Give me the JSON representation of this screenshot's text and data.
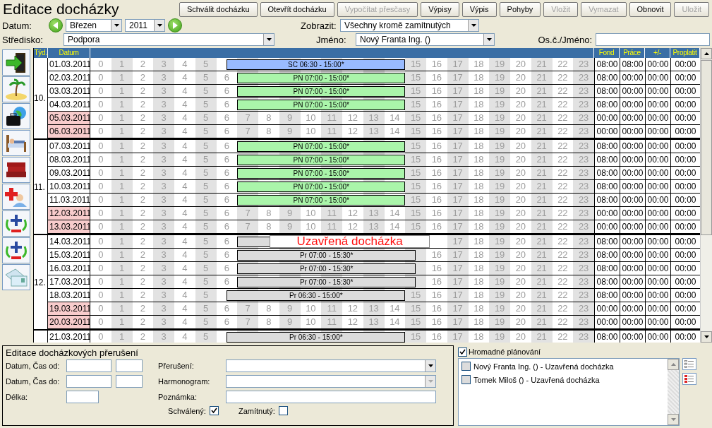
{
  "title": "Editace docházky",
  "toolbar": [
    {
      "label": "Schválit docházku",
      "disabled": false
    },
    {
      "label": "Otevřít docházku",
      "disabled": false
    },
    {
      "label": "Vypočítat přesčasy",
      "disabled": true
    },
    {
      "label": "Výpisy",
      "disabled": false
    },
    {
      "label": "Výpis",
      "disabled": false
    },
    {
      "label": "Pohyby",
      "disabled": false
    },
    {
      "label": "Vložit",
      "disabled": true
    },
    {
      "label": "Vymazat",
      "disabled": true
    },
    {
      "label": "Obnovit",
      "disabled": false
    },
    {
      "label": "Uložit",
      "disabled": true
    }
  ],
  "filters": {
    "datum_label": "Datum:",
    "month": "Březen",
    "year": "2011",
    "zobrazit_label": "Zobrazit:",
    "zobrazit": "Všechny kromě zamítnutých",
    "stredisko_label": "Středisko:",
    "stredisko": "Podpora",
    "jmeno_label": "Jméno:",
    "jmeno": "Nový Franta Ing. ()",
    "search_label": "Os.č./Jméno:"
  },
  "table": {
    "columns": {
      "week": "Týd.",
      "date": "Datum",
      "fond": "Fond",
      "prace": "Práce",
      "diff": "+/-",
      "paid": "Proplatit"
    },
    "weeks": [
      {
        "label": "10.",
        "days": [
          {
            "date": "01.03.2011",
            "weekend": false,
            "hours_before": [
              "0",
              "1",
              "2",
              "3",
              "4",
              "5"
            ],
            "hours_after": [
              "15",
              "16",
              "17",
              "18",
              "19",
              "20",
              "21",
              "22",
              "23"
            ],
            "bar": {
              "label": "SC 06:30 - 15:00*",
              "color": "#99bbff"
            },
            "fond": "08:00",
            "prace": "08:00",
            "diff": "00:00",
            "paid": "00:00"
          },
          {
            "date": "02.03.2011",
            "weekend": false,
            "hours_before": [
              "0",
              "1",
              "2",
              "3",
              "4",
              "5",
              "6"
            ],
            "hours_after": [
              "15",
              "16",
              "17",
              "18",
              "19",
              "20",
              "21",
              "22",
              "23"
            ],
            "bar": {
              "label": "PN 07:00 - 15:00*",
              "color": "#aaf5aa"
            },
            "fond": "08:00",
            "prace": "00:00",
            "diff": "00:00",
            "paid": "00:00"
          },
          {
            "date": "03.03.2011",
            "weekend": false,
            "hours_before": [
              "0",
              "1",
              "2",
              "3",
              "4",
              "5",
              "6"
            ],
            "hours_after": [
              "15",
              "16",
              "17",
              "18",
              "19",
              "20",
              "21",
              "22",
              "23"
            ],
            "bar": {
              "label": "PN 07:00 - 15:00*",
              "color": "#aaf5aa"
            },
            "fond": "08:00",
            "prace": "00:00",
            "diff": "00:00",
            "paid": "00:00"
          },
          {
            "date": "04.03.2011",
            "weekend": false,
            "hours_before": [
              "0",
              "1",
              "2",
              "3",
              "4",
              "5",
              "6"
            ],
            "hours_after": [
              "15",
              "16",
              "17",
              "18",
              "19",
              "20",
              "21",
              "22",
              "23"
            ],
            "bar": {
              "label": "PN 07:00 - 15:00*",
              "color": "#aaf5aa"
            },
            "fond": "08:00",
            "prace": "00:00",
            "diff": "00:00",
            "paid": "00:00"
          },
          {
            "date": "05.03.2011",
            "weekend": true,
            "hours_before": [
              "0",
              "1",
              "2",
              "3",
              "4",
              "5",
              "6",
              "7",
              "8",
              "9",
              "10",
              "11",
              "12",
              "13",
              "14",
              "15",
              "16",
              "17",
              "18",
              "19",
              "20",
              "21",
              "22",
              "23"
            ],
            "fond": "00:00",
            "prace": "00:00",
            "diff": "00:00",
            "paid": "00:00"
          },
          {
            "date": "06.03.2011",
            "weekend": true,
            "hours_before": [
              "0",
              "1",
              "2",
              "3",
              "4",
              "5",
              "6",
              "7",
              "8",
              "9",
              "10",
              "11",
              "12",
              "13",
              "14",
              "15",
              "16",
              "17",
              "18",
              "19",
              "20",
              "21",
              "22",
              "23"
            ],
            "fond": "00:00",
            "prace": "00:00",
            "diff": "00:00",
            "paid": "00:00"
          }
        ]
      },
      {
        "label": "11.",
        "days": [
          {
            "date": "07.03.2011",
            "weekend": false,
            "hours_before": [
              "0",
              "1",
              "2",
              "3",
              "4",
              "5",
              "6"
            ],
            "hours_after": [
              "15",
              "16",
              "17",
              "18",
              "19",
              "20",
              "21",
              "22",
              "23"
            ],
            "bar": {
              "label": "PN 07:00 - 15:00*",
              "color": "#aaf5aa"
            },
            "fond": "08:00",
            "prace": "00:00",
            "diff": "00:00",
            "paid": "00:00"
          },
          {
            "date": "08.03.2011",
            "weekend": false,
            "hours_before": [
              "0",
              "1",
              "2",
              "3",
              "4",
              "5",
              "6"
            ],
            "hours_after": [
              "15",
              "16",
              "17",
              "18",
              "19",
              "20",
              "21",
              "22",
              "23"
            ],
            "bar": {
              "label": "PN 07:00 - 15:00*",
              "color": "#aaf5aa"
            },
            "fond": "08:00",
            "prace": "00:00",
            "diff": "00:00",
            "paid": "00:00"
          },
          {
            "date": "09.03.2011",
            "weekend": false,
            "hours_before": [
              "0",
              "1",
              "2",
              "3",
              "4",
              "5",
              "6"
            ],
            "hours_after": [
              "15",
              "16",
              "17",
              "18",
              "19",
              "20",
              "21",
              "22",
              "23"
            ],
            "bar": {
              "label": "PN 07:00 - 15:00*",
              "color": "#aaf5aa"
            },
            "fond": "08:00",
            "prace": "00:00",
            "diff": "00:00",
            "paid": "00:00"
          },
          {
            "date": "10.03.2011",
            "weekend": false,
            "hours_before": [
              "0",
              "1",
              "2",
              "3",
              "4",
              "5",
              "6"
            ],
            "hours_after": [
              "15",
              "16",
              "17",
              "18",
              "19",
              "20",
              "21",
              "22",
              "23"
            ],
            "bar": {
              "label": "PN 07:00 - 15:00*",
              "color": "#aaf5aa"
            },
            "fond": "08:00",
            "prace": "00:00",
            "diff": "00:00",
            "paid": "00:00"
          },
          {
            "date": "11.03.2011",
            "weekend": false,
            "hours_before": [
              "0",
              "1",
              "2",
              "3",
              "4",
              "5",
              "6"
            ],
            "hours_after": [
              "15",
              "16",
              "17",
              "18",
              "19",
              "20",
              "21",
              "22",
              "23"
            ],
            "bar": {
              "label": "PN 07:00 - 15:00*",
              "color": "#aaf5aa"
            },
            "fond": "08:00",
            "prace": "00:00",
            "diff": "00:00",
            "paid": "00:00"
          },
          {
            "date": "12.03.2011",
            "weekend": true,
            "hours_before": [
              "0",
              "1",
              "2",
              "3",
              "4",
              "5",
              "6",
              "7",
              "8",
              "9",
              "10",
              "11",
              "12",
              "13",
              "14",
              "15",
              "16",
              "17",
              "18",
              "19",
              "20",
              "21",
              "22",
              "23"
            ],
            "fond": "00:00",
            "prace": "00:00",
            "diff": "00:00",
            "paid": "00:00"
          },
          {
            "date": "13.03.2011",
            "weekend": true,
            "hours_before": [
              "0",
              "1",
              "2",
              "3",
              "4",
              "5",
              "6",
              "7",
              "8",
              "9",
              "10",
              "11",
              "12",
              "13",
              "14",
              "15",
              "16",
              "17",
              "18",
              "19",
              "20",
              "21",
              "22",
              "23"
            ],
            "fond": "00:00",
            "prace": "00:00",
            "diff": "00:00",
            "paid": "00:00"
          }
        ]
      },
      {
        "label": "12.",
        "days": [
          {
            "date": "14.03.2011",
            "weekend": false,
            "hours_before": [
              "0",
              "1",
              "2",
              "3",
              "4",
              "5",
              "6"
            ],
            "hours_after": [
              "17",
              "18",
              "19",
              "20",
              "21",
              "22",
              "23"
            ],
            "bar": {
              "color": "#dcdcdc"
            },
            "notice": "Uzavřená docházka",
            "fond": "08:00",
            "prace": "00:00",
            "diff": "00:00",
            "paid": "00:00"
          },
          {
            "date": "15.03.2011",
            "weekend": false,
            "hours_before": [
              "0",
              "1",
              "2",
              "3",
              "4",
              "5",
              "6"
            ],
            "hours_after": [
              "16",
              "17",
              "18",
              "19",
              "20",
              "21",
              "22",
              "23"
            ],
            "bar": {
              "label": "Pr 07:00 - 15:30*",
              "color": "#dcdcdc"
            },
            "fond": "08:00",
            "prace": "00:00",
            "diff": "00:00",
            "paid": "00:00"
          },
          {
            "date": "16.03.2011",
            "weekend": false,
            "hours_before": [
              "0",
              "1",
              "2",
              "3",
              "4",
              "5",
              "6"
            ],
            "hours_after": [
              "16",
              "17",
              "18",
              "19",
              "20",
              "21",
              "22",
              "23"
            ],
            "bar": {
              "label": "Pr 07:00 - 15:30*",
              "color": "#dcdcdc"
            },
            "fond": "08:00",
            "prace": "00:00",
            "diff": "00:00",
            "paid": "00:00"
          },
          {
            "date": "17.03.2011",
            "weekend": false,
            "hours_before": [
              "0",
              "1",
              "2",
              "3",
              "4",
              "5",
              "6"
            ],
            "hours_after": [
              "16",
              "17",
              "18",
              "19",
              "20",
              "21",
              "22",
              "23"
            ],
            "bar": {
              "label": "Pr 07:00 - 15:30*",
              "color": "#dcdcdc"
            },
            "fond": "08:00",
            "prace": "00:00",
            "diff": "00:00",
            "paid": "00:00"
          },
          {
            "date": "18.03.2011",
            "weekend": false,
            "hours_before": [
              "0",
              "1",
              "2",
              "3",
              "4",
              "5"
            ],
            "hours_after": [
              "15",
              "16",
              "17",
              "18",
              "19",
              "20",
              "21",
              "22",
              "23"
            ],
            "bar": {
              "label": "Pr 06:30 - 15:00*",
              "color": "#dcdcdc"
            },
            "fond": "08:00",
            "prace": "00:00",
            "diff": "00:00",
            "paid": "00:00"
          },
          {
            "date": "19.03.2011",
            "weekend": true,
            "hours_before": [
              "0",
              "1",
              "2",
              "3",
              "4",
              "5",
              "6",
              "7",
              "8",
              "9",
              "10",
              "11",
              "12",
              "13",
              "14",
              "15",
              "16",
              "17",
              "18",
              "19",
              "20",
              "21",
              "22",
              "23"
            ],
            "fond": "00:00",
            "prace": "00:00",
            "diff": "00:00",
            "paid": "00:00"
          },
          {
            "date": "20.03.2011",
            "weekend": true,
            "hours_before": [
              "0",
              "1",
              "2",
              "3",
              "4",
              "5",
              "6",
              "7",
              "8",
              "9",
              "10",
              "11",
              "12",
              "13",
              "14",
              "15",
              "16",
              "17",
              "18",
              "19",
              "20",
              "21",
              "22",
              "23"
            ],
            "fond": "00:00",
            "prace": "00:00",
            "diff": "00:00",
            "paid": "00:00"
          }
        ]
      },
      {
        "days": [
          {
            "date": "21.03.2011",
            "weekend": false,
            "hours_before": [
              "0",
              "1",
              "2",
              "3",
              "4",
              "5"
            ],
            "hours_after": [
              "15",
              "16",
              "17",
              "18",
              "19",
              "20",
              "21",
              "22",
              "23"
            ],
            "bar": {
              "label": "Pr 06:30 - 15:00*",
              "color": "#dcdcdc"
            },
            "fond": "08:00",
            "prace": "00:00",
            "diff": "00:00",
            "paid": "00:00"
          }
        ]
      }
    ]
  },
  "editor": {
    "title": "Editace docházkových přerušení",
    "from_label": "Datum, Čas od:",
    "to_label": "Datum, Čas do:",
    "length_label": "Délka:",
    "break_label": "Přerušení:",
    "schedule_label": "Harmonogram:",
    "schedule_disabled": true,
    "note_label": "Poznámka:",
    "approved_label": "Schválený:",
    "approved": true,
    "rejected_label": "Zamítnutý:",
    "rejected": false
  },
  "bulk": {
    "label": "Hromadné plánování",
    "checked": true,
    "items": [
      {
        "label": "Nový Franta Ing. () - Uzavřená docházka",
        "checked": false
      },
      {
        "label": "Tomek Miloš () - Uzavřená docházka",
        "checked": false
      }
    ]
  }
}
